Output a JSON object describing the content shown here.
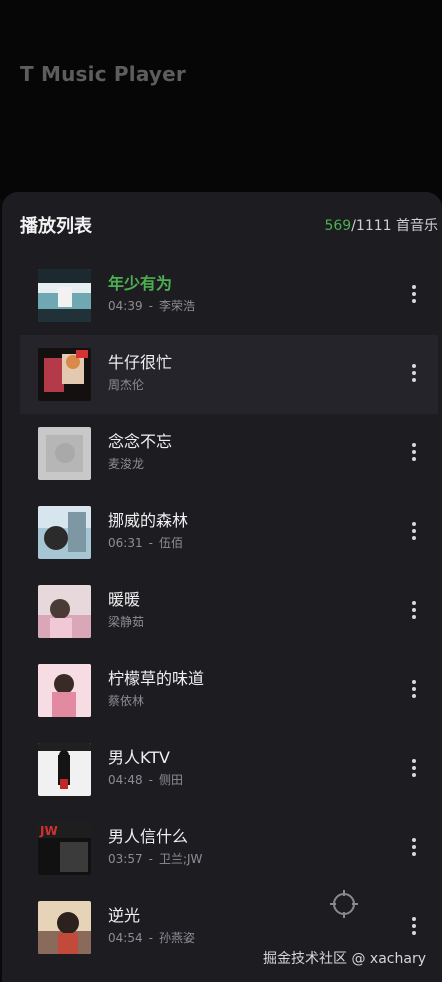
{
  "app": {
    "title": "T Music Player"
  },
  "playlist": {
    "title": "播放列表",
    "count_current": "569",
    "count_total": "/1111 首音乐",
    "songs": [
      {
        "title": "年少有为",
        "duration": "04:39",
        "artist": "李荣浩",
        "playing": true,
        "cover": "cover-nianshao"
      },
      {
        "title": "牛仔很忙",
        "duration": "",
        "artist": "周杰伦",
        "playing": false,
        "cover": "cover-niuzai"
      },
      {
        "title": "念念不忘",
        "duration": "",
        "artist": "麦浚龙",
        "playing": false,
        "cover": "cover-niannian"
      },
      {
        "title": "挪威的森林",
        "duration": "06:31",
        "artist": "伍佰",
        "playing": false,
        "cover": "cover-nuowei"
      },
      {
        "title": "暖暖",
        "duration": "",
        "artist": "梁静茹",
        "playing": false,
        "cover": "cover-nuannuan"
      },
      {
        "title": "柠檬草的味道",
        "duration": "",
        "artist": "蔡依林",
        "playing": false,
        "cover": "cover-ningmeng"
      },
      {
        "title": "男人KTV",
        "duration": "04:48",
        "artist": "侧田",
        "playing": false,
        "cover": "cover-nanren-ktv"
      },
      {
        "title": "男人信什么",
        "duration": "03:57",
        "artist": "卫兰;JW",
        "playing": false,
        "cover": "cover-nanren-xin"
      },
      {
        "title": "逆光",
        "duration": "04:54",
        "artist": "孙燕姿",
        "playing": false,
        "cover": "cover-niguang"
      }
    ],
    "meta_separator": "-"
  },
  "icons": {
    "more": "more-vertical-icon",
    "locate": "locate-crosshair-icon"
  },
  "watermark": "掘金技术社区 @ xachary",
  "colors": {
    "accent": "#4caf50",
    "sheet_bg": "#1d1c21",
    "active_row_bg": "#25242a",
    "secondary_text": "#8e8d93"
  }
}
